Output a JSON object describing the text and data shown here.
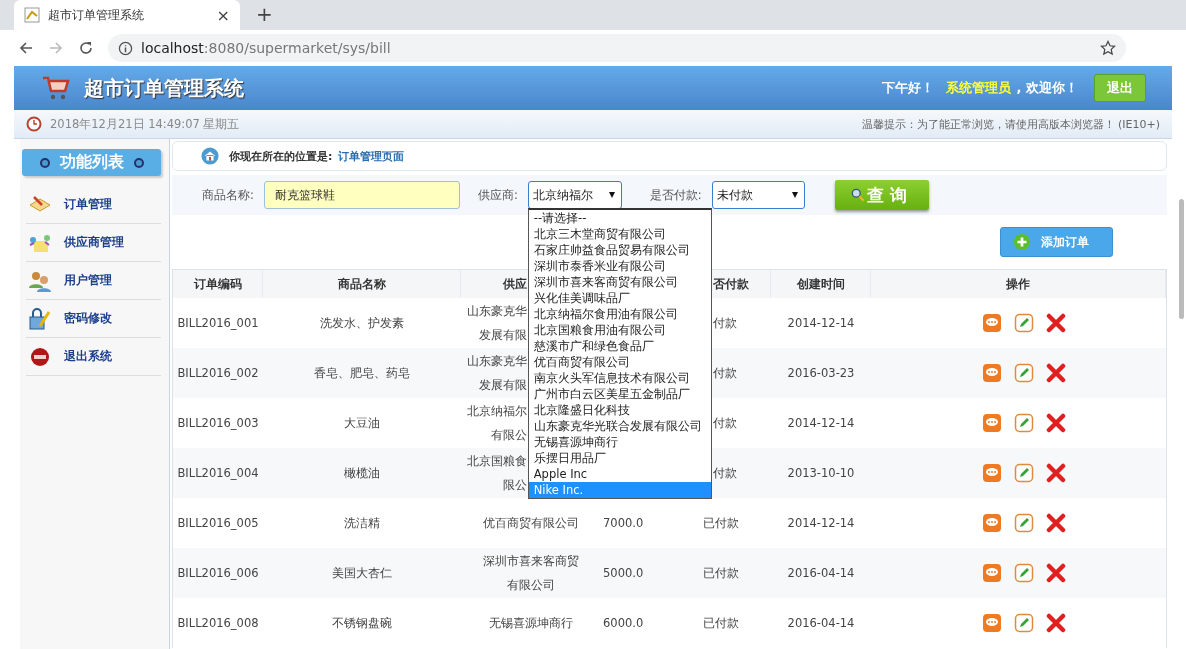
{
  "browser": {
    "tab_title": "超市订单管理系统",
    "tab_close": "×",
    "new_tab": "+",
    "url_host": "localhost",
    "url_path": ":8080/supermarket/sys/bill"
  },
  "header": {
    "title": "超市订单管理系统",
    "greeting": "下午好！",
    "user": "系统管理员",
    "welcome": ", 欢迎你！",
    "logout": "退出"
  },
  "info_bar": {
    "datetime": "2018年12月21日 14:49:07 星期五",
    "notice": "温馨提示：为了能正常浏览，请使用高版本浏览器！ (IE10+)"
  },
  "sidebar": {
    "title": "功能列表",
    "items": [
      {
        "label": "订单管理",
        "kind": "order"
      },
      {
        "label": "供应商管理",
        "kind": "supplier"
      },
      {
        "label": "用户管理",
        "kind": "user"
      },
      {
        "label": "密码修改",
        "kind": "password"
      },
      {
        "label": "退出系统",
        "kind": "exit"
      }
    ]
  },
  "breadcrumb": {
    "prefix": "你现在所在的位置是:",
    "page": "订单管理页面"
  },
  "search": {
    "name_label": "商品名称:",
    "name_value": "耐克篮球鞋",
    "supplier_label": "供应商:",
    "supplier_value": "北京纳福尔",
    "paid_label": "是否付款:",
    "paid_value": "未付款",
    "query": "查询"
  },
  "supplier_options": [
    {
      "label": "--请选择--",
      "selected": false
    },
    {
      "label": "北京三木堂商贸有限公司",
      "selected": false
    },
    {
      "label": "石家庄帅益食品贸易有限公司",
      "selected": false
    },
    {
      "label": "深圳市泰香米业有限公司",
      "selected": false
    },
    {
      "label": "深圳市喜来客商贸有限公司",
      "selected": false
    },
    {
      "label": "兴化佳美调味品厂",
      "selected": false
    },
    {
      "label": "北京纳福尔食用油有限公司",
      "selected": false
    },
    {
      "label": "北京国粮食用油有限公司",
      "selected": false
    },
    {
      "label": "慈溪市广和绿色食品厂",
      "selected": false
    },
    {
      "label": "优百商贸有限公司",
      "selected": false
    },
    {
      "label": "南京火头军信息技术有限公司",
      "selected": false
    },
    {
      "label": "广州市白云区美星五金制品厂",
      "selected": false
    },
    {
      "label": "北京隆盛日化科技",
      "selected": false
    },
    {
      "label": "山东豪克华光联合发展有限公司",
      "selected": false
    },
    {
      "label": "无锡喜源坤商行",
      "selected": false
    },
    {
      "label": "乐摆日用品厂",
      "selected": false
    },
    {
      "label": "Apple Inc",
      "selected": false
    },
    {
      "label": "Nike Inc.",
      "selected": true
    }
  ],
  "add_button": "添加订单",
  "table": {
    "columns": [
      {
        "label": "订单编码",
        "kind": "plain"
      },
      {
        "label": "商品名称",
        "kind": "plain"
      },
      {
        "label": "供应",
        "kind": "covered"
      },
      {
        "label": "否付款",
        "kind": "covered"
      },
      {
        "label": "创建时间",
        "kind": "plain"
      },
      {
        "label": "操作",
        "kind": "plain"
      }
    ],
    "rows": [
      {
        "kind": "covered",
        "code": "BILL2016_001",
        "name": "洗发水、护发素",
        "supplier": [
          "山东豪克华",
          "发展有限"
        ],
        "paid": "付款",
        "date": "2014-12-14"
      },
      {
        "kind": "covered",
        "code": "BILL2016_002",
        "name": "香皂、肥皂、药皂",
        "supplier": [
          "山东豪克华",
          "发展有限"
        ],
        "paid": "付款",
        "date": "2016-03-23"
      },
      {
        "kind": "covered",
        "code": "BILL2016_003",
        "name": "大豆油",
        "supplier": [
          "北京纳福尔",
          "有限公"
        ],
        "paid": "付款",
        "date": "2014-12-14"
      },
      {
        "kind": "covered",
        "code": "BILL2016_004",
        "name": "橄榄油",
        "supplier": [
          "北京国粮食",
          "限公"
        ],
        "paid": "付款",
        "date": "2013-10-10"
      },
      {
        "kind": "plain",
        "code": "BILL2016_005",
        "name": "洗洁精",
        "supplier": [
          "优百商贸有限公司"
        ],
        "amount": "7000.0",
        "paid": "已付款",
        "date": "2014-12-14"
      },
      {
        "kind": "plain",
        "code": "BILL2016_006",
        "name": "美国大杏仁",
        "supplier": [
          "深圳市喜来客商贸",
          "有限公司"
        ],
        "amount": "5000.0",
        "paid": "已付款",
        "date": "2016-04-14"
      },
      {
        "kind": "plain",
        "code": "BILL2016_008",
        "name": "不锈钢盘碗",
        "supplier": [
          "无锡喜源坤商行"
        ],
        "amount": "6000.0",
        "paid": "已付款",
        "date": "2016-04-14"
      }
    ]
  }
}
